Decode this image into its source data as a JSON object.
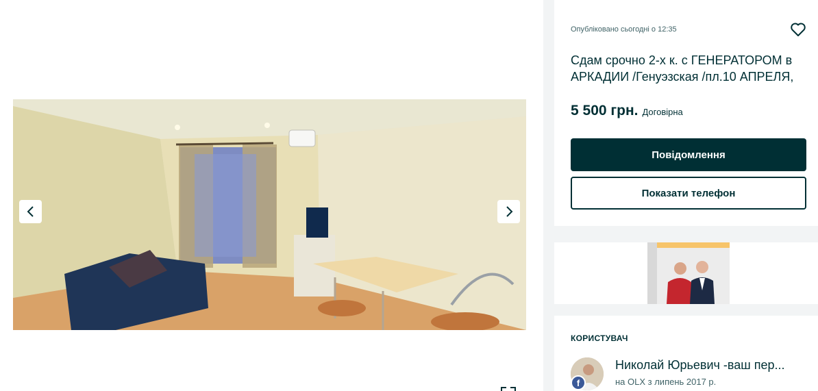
{
  "gallery": {
    "prev_icon": "chevron-left-icon",
    "next_icon": "chevron-right-icon",
    "fullscreen_icon": "fullscreen-icon"
  },
  "ad": {
    "published": "Опубліковано сьогодні о 12:35",
    "favorite_icon": "heart-icon",
    "title_line1": "Сдам срочно 2-х к. с ГЕНЕРАТОРОМ в",
    "title_line2": "АРКАДИИ /Генуэзская /пл.10 АПРЕЛЯ,",
    "price": "5 500 грн.",
    "negotiable": "Договірна",
    "message_button": "Повідомлення",
    "phone_button": "Показати телефон"
  },
  "user": {
    "heading": "КОРИСТУВАЧ",
    "name": "Николай Юрьевич -ваш пер...",
    "since": "на OLX з липень 2017 р.",
    "badge": "f"
  },
  "colors": {
    "primary": "#002f34",
    "background": "#f2f4f5",
    "card": "#ffffff",
    "facebook": "#3b5998"
  }
}
